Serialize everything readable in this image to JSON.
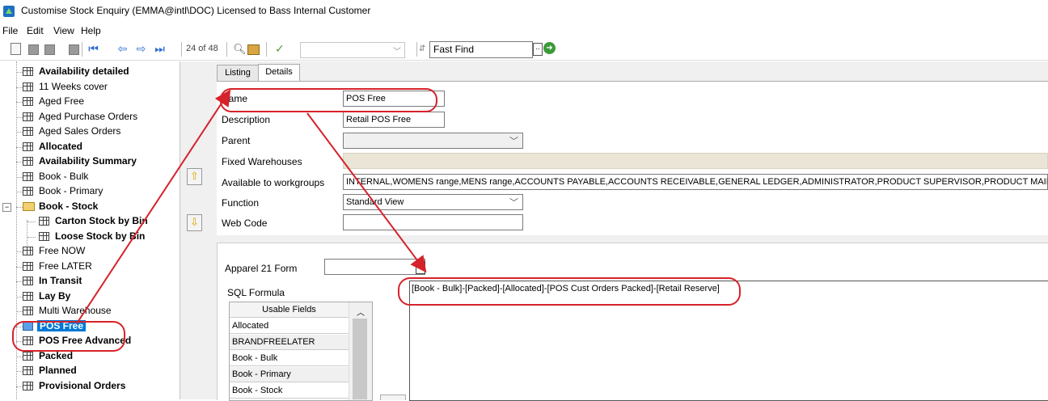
{
  "window": {
    "title": "Customise Stock Enquiry (EMMA@intl\\DOC) Licensed to Bass Internal Customer"
  },
  "menu": [
    "File",
    "Edit",
    "View",
    "Help"
  ],
  "toolbar": {
    "pager": "24 of 48",
    "fast_find_label": "Fast Find",
    "fast_find_value": ""
  },
  "tree": {
    "items": [
      {
        "label": "Availability detailed",
        "bold": true
      },
      {
        "label": "11 Weeks cover",
        "bold": false
      },
      {
        "label": "Aged Free",
        "bold": false
      },
      {
        "label": "Aged Purchase Orders",
        "bold": false
      },
      {
        "label": "Aged Sales Orders",
        "bold": false
      },
      {
        "label": "Allocated",
        "bold": true
      },
      {
        "label": "Availability Summary",
        "bold": true
      },
      {
        "label": "Book - Bulk",
        "bold": false
      },
      {
        "label": "Book - Primary",
        "bold": false
      },
      {
        "label": "Book - Stock",
        "bold": true,
        "folder": true
      },
      {
        "label": "Carton Stock by Bin",
        "bold": true,
        "child": true
      },
      {
        "label": "Loose Stock by Bin",
        "bold": true,
        "child": true
      },
      {
        "label": "Free NOW",
        "bold": false
      },
      {
        "label": "Free LATER",
        "bold": false
      },
      {
        "label": "In Transit",
        "bold": true
      },
      {
        "label": "Lay By",
        "bold": true
      },
      {
        "label": "Multi Warehouse",
        "bold": false
      },
      {
        "label": "POS Free",
        "bold": true,
        "selected": true
      },
      {
        "label": "POS Free Advanced",
        "bold": true
      },
      {
        "label": "Packed",
        "bold": true
      },
      {
        "label": "Planned",
        "bold": true
      },
      {
        "label": "Provisional Orders",
        "bold": true
      }
    ]
  },
  "tabs": {
    "listing": "Listing",
    "details": "Details"
  },
  "details": {
    "name_label": "Name",
    "name_value": "POS Free",
    "description_label": "Description",
    "description_value": "Retail POS Free",
    "parent_label": "Parent",
    "parent_value": "",
    "fixed_warehouses_label": "Fixed Warehouses",
    "workgroups_label": "Available to workgroups",
    "workgroups_value": "INTERNAL,WOMENS range,MENS range,ACCOUNTS PAYABLE,ACCOUNTS RECEIVABLE,GENERAL LEDGER,ADMINISTRATOR,PRODUCT SUPERVISOR,PRODUCT MAINTENA",
    "function_label": "Function",
    "function_value": "Standard View",
    "webcode_label": "Web Code",
    "webcode_value": ""
  },
  "formula": {
    "apparel_label": "Apparel 21 Form",
    "apparel_value": "",
    "sql_label": "SQL Formula",
    "sql_value": "[Book - Bulk]-[Packed]-[Allocated]-[POS Cust Orders Packed]-[Retail Reserve]",
    "fields_header": "Usable Fields",
    "fields": [
      "Allocated",
      "BRANDFREELATER",
      "Book - Bulk",
      "Book - Primary",
      "Book - Stock"
    ]
  },
  "annotation_color": "#d6222a"
}
